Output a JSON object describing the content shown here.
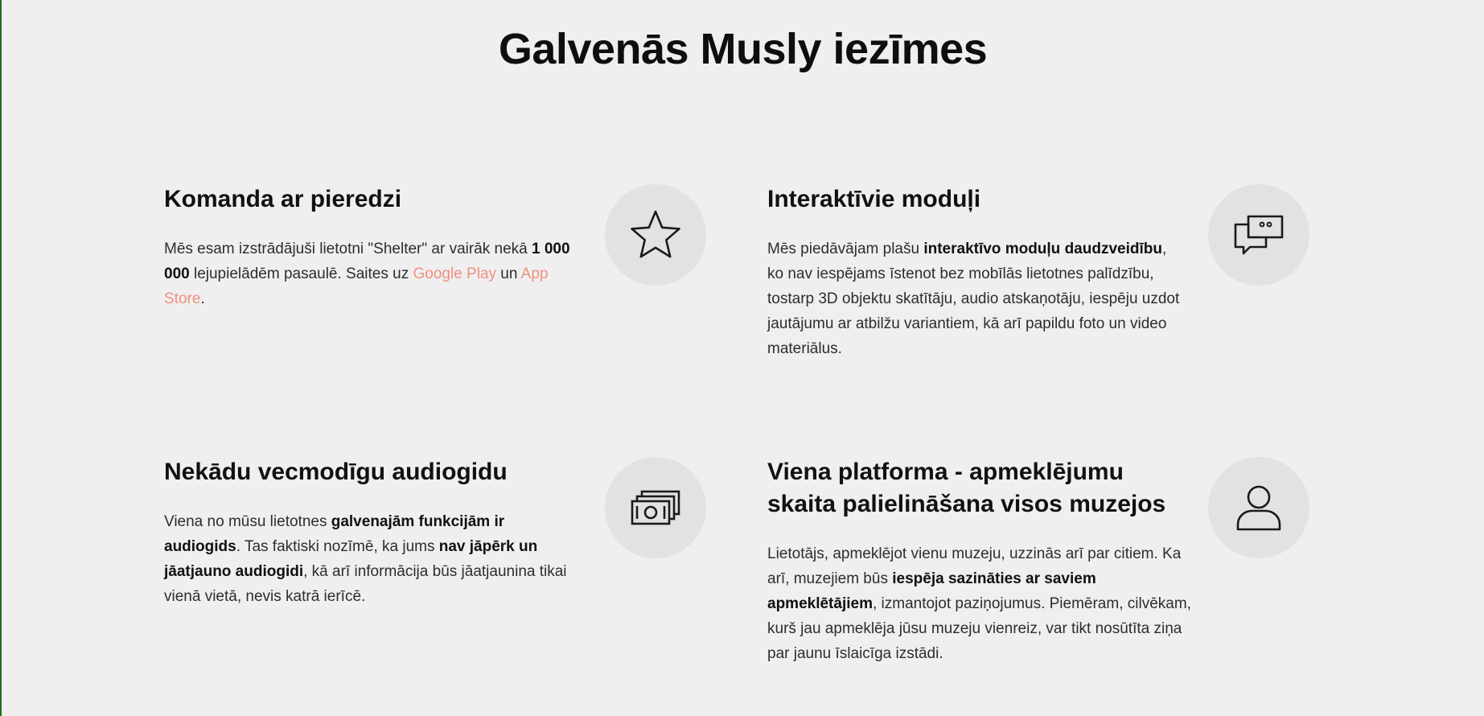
{
  "page": {
    "title": "Galvenās Musly iezīmes"
  },
  "features": [
    {
      "title": "Komanda ar pieredzi",
      "icon": "star-icon",
      "text": {
        "t1": "Mēs esam izstrādājuši lietotni \"Shelter\" ar vairāk nekā ",
        "b1": "1 000 000",
        "t2": " lejupielādēm pasaulē. Saites uz ",
        "link1": "Google Play",
        "t3": " un ",
        "link2": "App Store",
        "t4": "."
      }
    },
    {
      "title": "Interaktīvie moduļi",
      "icon": "chat-bubbles-icon",
      "text": {
        "t1": "Mēs piedāvājam plašu ",
        "b1": "interaktīvo moduļu daudzveidību",
        "t2": ", ko nav iespējams īstenot bez mobīlās lietotnes palīdzību, tostarp 3D objektu skatītāju, audio atskaņotāju, iespēju uzdot jautājumu ar atbilžu variantiem, kā arī papildu foto un video materiālus."
      }
    },
    {
      "title": "Nekādu vecmodīgu audiogidu",
      "icon": "cash-stack-icon",
      "text": {
        "t1": "Viena no mūsu lietotnes ",
        "b1": "galvenajām funkcijām ir audiogids",
        "t2": ". Tas faktiski nozīmē, ka jums ",
        "b2": "nav jāpērk un jāatjauno audiogidi",
        "t3": ", kā arī informācija būs jāatjaunina tikai vienā vietā, nevis katrā ierīcē."
      }
    },
    {
      "title": "Viena platforma - apmeklējumu skaita palielināšana visos muzejos",
      "icon": "user-icon",
      "text": {
        "t1": "Lietotājs, apmeklējot vienu muzeju, uzzinās arī par citiem. Ka arī, muzejiem būs ",
        "b1": "iespēja sazināties ar saviem apmeklētājiem",
        "t2": ", izmantojot paziņojumus. Piemēram, cilvēkam, kurš jau apmeklēja jūsu muzeju vienreiz, var tikt nosūtīta ziņa par jaunu īslaicīga izstādi."
      }
    }
  ]
}
